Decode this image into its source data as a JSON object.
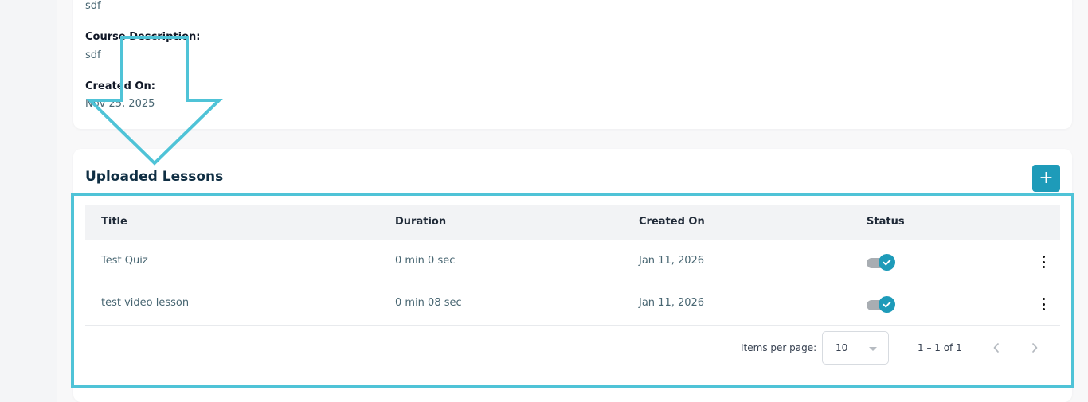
{
  "course_info": {
    "name_value": "sdf",
    "description_label": "Course Description:",
    "description_value": "sdf",
    "created_label": "Created On:",
    "created_value": "Nov 25, 2025"
  },
  "lessons": {
    "title": "Uploaded Lessons",
    "add_label": "+",
    "columns": [
      "Title",
      "Duration",
      "Created On",
      "Status"
    ],
    "rows": [
      {
        "title": "Test Quiz",
        "duration": "0 min 0 sec",
        "created_on": "Jan 11, 2026",
        "status_active": true
      },
      {
        "title": "test video lesson",
        "duration": "0 min 08 sec",
        "created_on": "Jan 11, 2026",
        "status_active": true
      }
    ],
    "pagination": {
      "items_per_page_label": "Items per page:",
      "items_per_page_value": "10",
      "range_label": "1 – 1 of 1"
    }
  },
  "icons": {
    "add": "plus-icon",
    "row_menu": "more-vertical-icon",
    "status": "check-icon",
    "prev": "chevron-left-icon",
    "next": "chevron-right-icon",
    "select": "caret-down-icon"
  },
  "colors": {
    "accent": "#1e9bb9",
    "annotation": "#4fc3d7",
    "title": "#0f2e43",
    "muted_text": "#486672"
  }
}
